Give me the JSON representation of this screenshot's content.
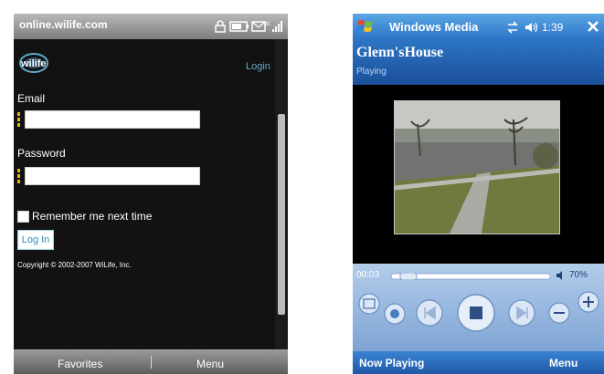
{
  "left_phone": {
    "status_bar": {
      "url": "online.wilife.com",
      "icons": [
        "lock-icon",
        "battery-icon",
        "message-icon",
        "signal-icon"
      ]
    },
    "page": {
      "logo_text": "wilife",
      "login_link": "Login",
      "email_label": "Email",
      "email_value": "",
      "password_label": "Password",
      "password_value": "",
      "remember_label": "Remember me next time",
      "remember_checked": false,
      "login_button": "Log In",
      "copyright": "Copyright © 2002-2007 WiLife, Inc."
    },
    "softkeys": {
      "left": "Favorites",
      "right": "Menu"
    },
    "colors": {
      "background": "#121212",
      "link": "#63a8c8",
      "caret": "#e8b60c"
    }
  },
  "right_phone": {
    "title_bar": {
      "app_name": "Windows Media",
      "time": "1:39",
      "icons": [
        "windows-start-icon",
        "connectivity-icon",
        "volume-icon",
        "close-icon"
      ]
    },
    "header": {
      "title": "Glenn'sHouse",
      "status": "Playing"
    },
    "player": {
      "elapsed": "00:03",
      "volume": "70%",
      "progress_fraction": 0.04,
      "volume_fraction": 0.7,
      "buttons": [
        "playlist-icon",
        "web-icon",
        "previous-icon",
        "stop-icon",
        "next-icon",
        "volume-down-icon",
        "volume-up-icon"
      ]
    },
    "softkeys": {
      "left": "Now Playing",
      "right": "Menu"
    },
    "colors": {
      "title_bar": "#2b71c6",
      "controls": "#9ab8df"
    }
  }
}
